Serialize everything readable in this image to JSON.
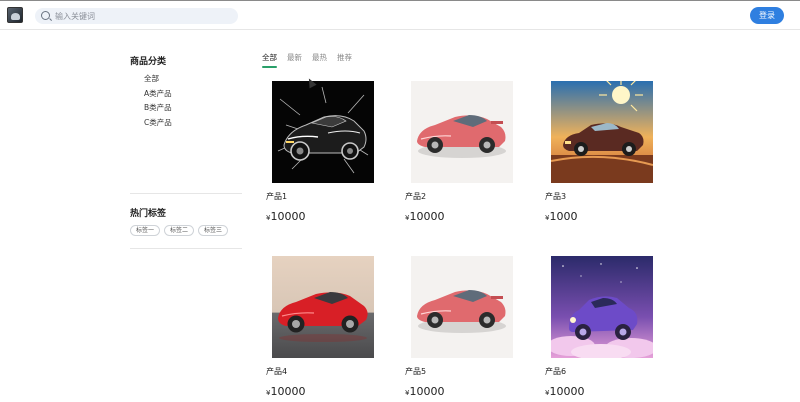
{
  "header": {
    "search_placeholder": "输入关键词",
    "login_label": "登录"
  },
  "sidebar": {
    "category_title": "商品分类",
    "categories": [
      "全部",
      "A类产品",
      "B类产品",
      "C类产品"
    ],
    "tags_title": "热门标签",
    "tags": [
      "标签一",
      "标签二",
      "标签三"
    ]
  },
  "tabs": [
    "全部",
    "最新",
    "最热",
    "推荐"
  ],
  "active_tab": "全部",
  "currency_symbol": "¥",
  "products": [
    {
      "name": "产品1",
      "price": "10000",
      "image": "black-sports-car"
    },
    {
      "name": "产品2",
      "price": "10000",
      "image": "pink-sports-car"
    },
    {
      "name": "产品3",
      "price": "1000",
      "image": "vintage-car-sunset"
    },
    {
      "name": "产品4",
      "price": "10000",
      "image": "red-sports-car"
    },
    {
      "name": "产品5",
      "price": "10000",
      "image": "pink-sports-car"
    },
    {
      "name": "产品6",
      "price": "10000",
      "image": "purple-cartoon-car"
    }
  ],
  "colors": {
    "accent": "#2f7fe0",
    "tab_underline": "#2aa06a",
    "search_bg": "#eef2f8"
  }
}
